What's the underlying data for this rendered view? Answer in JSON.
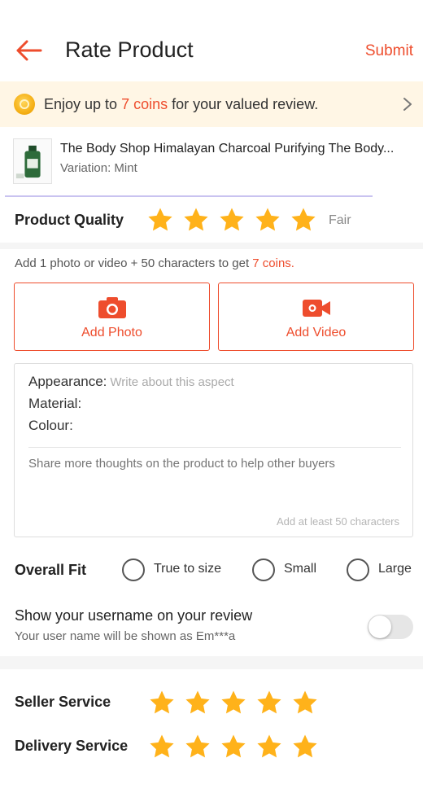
{
  "header": {
    "title": "Rate Product",
    "submit_label": "Submit"
  },
  "banner": {
    "text_before": "Enjoy up to ",
    "coins_text": "7 coins",
    "text_after": " for your valued review."
  },
  "product": {
    "name": "The Body Shop Himalayan Charcoal Purifying The Body...",
    "variation": "Variation: Mint"
  },
  "quality": {
    "label": "Product Quality",
    "rating": 5,
    "max_rating": 5,
    "rating_word": "Fair"
  },
  "media": {
    "hint_before": "Add 1 photo or video +  50 characters to get ",
    "hint_coins": "7 coins.",
    "add_photo_label": "Add Photo",
    "add_video_label": "Add Video"
  },
  "review": {
    "aspects": [
      {
        "label": "Appearance:",
        "placeholder": "Write about this aspect"
      },
      {
        "label": "Material:",
        "placeholder": ""
      },
      {
        "label": "Colour:",
        "placeholder": ""
      }
    ],
    "thoughts_placeholder": "Share more thoughts on the product to help other buyers",
    "min_chars_hint": "Add at least 50 characters"
  },
  "fit": {
    "label": "Overall Fit",
    "options": [
      "True to size",
      "Small",
      "Large"
    ]
  },
  "username": {
    "title": "Show your username on your review",
    "subtitle": "Your user name will be shown as Em***a",
    "toggle_on": false
  },
  "seller_service": {
    "label": "Seller Service",
    "rating": 5
  },
  "delivery_service": {
    "label": "Delivery Service",
    "rating": 5
  },
  "colors": {
    "accent": "#ee4d2d",
    "star": "#ffb21a",
    "banner_bg": "#fff6e5"
  }
}
